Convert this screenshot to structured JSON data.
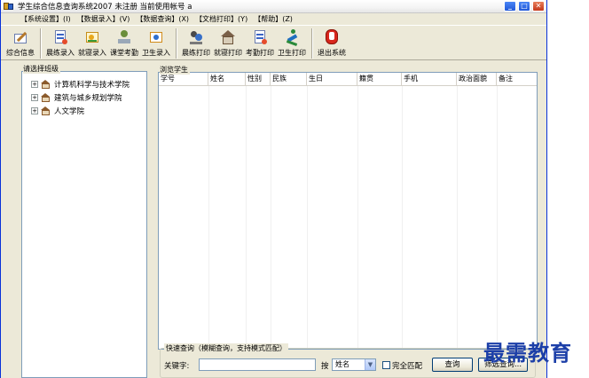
{
  "window": {
    "title": "学生综合信息查询系统2007 未注册  当前使用帐号 a"
  },
  "menu": [
    {
      "label": "【系统设置】(I)"
    },
    {
      "label": "【数据录入】(V)"
    },
    {
      "label": "【数据查询】(X)"
    },
    {
      "label": "【文档打印】(Y)"
    },
    {
      "label": "【帮助】(Z)"
    }
  ],
  "toolbar": {
    "general_info": "综合信息",
    "morning_entry": "晨练录入",
    "dorm_entry": "就寝录入",
    "class_attendance": "课堂考勤",
    "hygiene_entry": "卫生录入",
    "morning_print": "晨练打印",
    "dorm_print": "就寝打印",
    "attendance_print": "考勤打印",
    "hygiene_print": "卫生打印",
    "exit": "退出系统"
  },
  "left_panel": {
    "title": "请选择班级",
    "items": [
      {
        "label": "计算机科学与技术学院"
      },
      {
        "label": "建筑与城乡规划学院"
      },
      {
        "label": "人文学院"
      }
    ]
  },
  "right_panel": {
    "title": "浏览学生",
    "columns": [
      "学号",
      "姓名",
      "性别",
      "民族",
      "生日",
      "籍贯",
      "手机",
      "政治面貌",
      "备注"
    ]
  },
  "quick_search": {
    "title": "快速查询（模糊查询，支持模式匹配）",
    "keyword_label": "关键字:",
    "keyword_value": "",
    "by_label": "按",
    "field_selected": "姓名",
    "exact_match_label": "完全匹配",
    "exact_match_checked": false,
    "query_button": "查询",
    "filter_button": "筛选查询..."
  },
  "watermark": "最需教育"
}
